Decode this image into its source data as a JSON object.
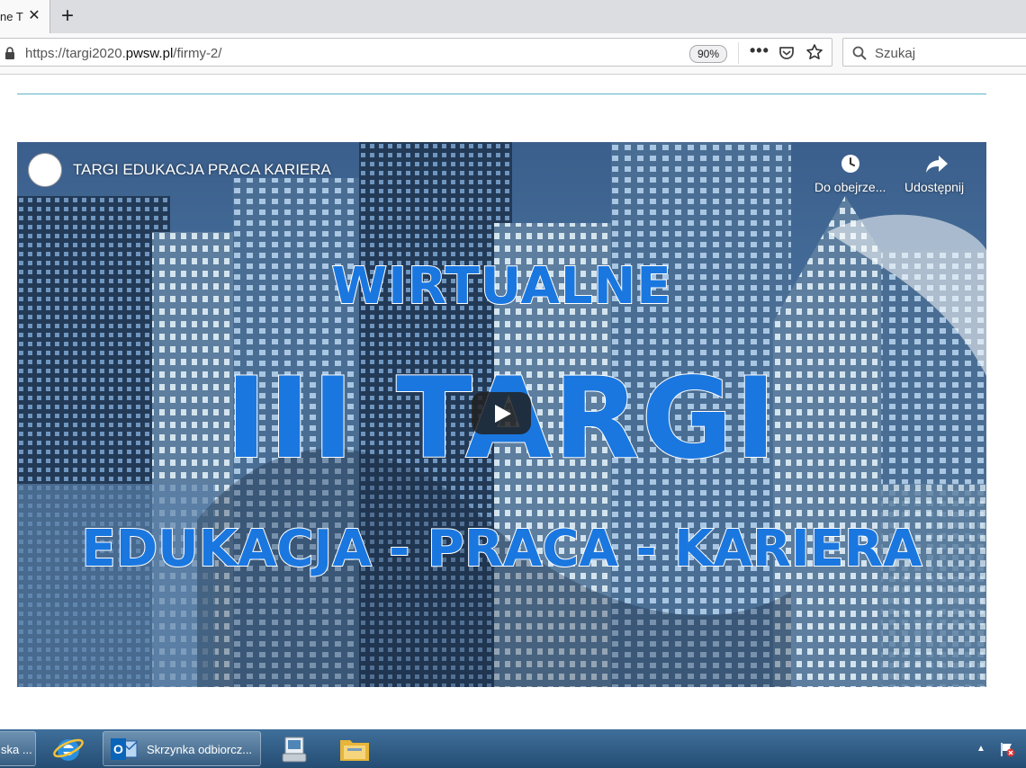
{
  "browser": {
    "tab": {
      "title": "ne T",
      "close_glyph": "✕"
    },
    "new_tab_glyph": "+",
    "url": {
      "prefix": "https://targi2020.",
      "domain": "pwsw.pl",
      "path": "/firmy-2/"
    },
    "zoom": "90%",
    "menu_glyph": "•••",
    "search_placeholder": "Szukaj",
    "icons": [
      "lock-icon",
      "pocket-icon",
      "bookmark-star-icon",
      "search-icon"
    ]
  },
  "page": {
    "divider_color": "#5fb3c7",
    "video": {
      "channel_title": "TARGI EDUKACJA PRACA KARIERA",
      "watch_later_label": "Do obejrze...",
      "share_label": "Udostępnij",
      "headline_top": "WIRTUALNE",
      "headline_main": "III TARGI",
      "headline_bottom": "EDUKACJA - PRACA - KARIERA",
      "text_color": "#1a77e0"
    }
  },
  "taskbar": {
    "items": [
      {
        "label": "ska ..."
      },
      {
        "label": ""
      },
      {
        "label": "Skrzynka odbiorcz..."
      }
    ],
    "tray_arrow": "▲"
  }
}
